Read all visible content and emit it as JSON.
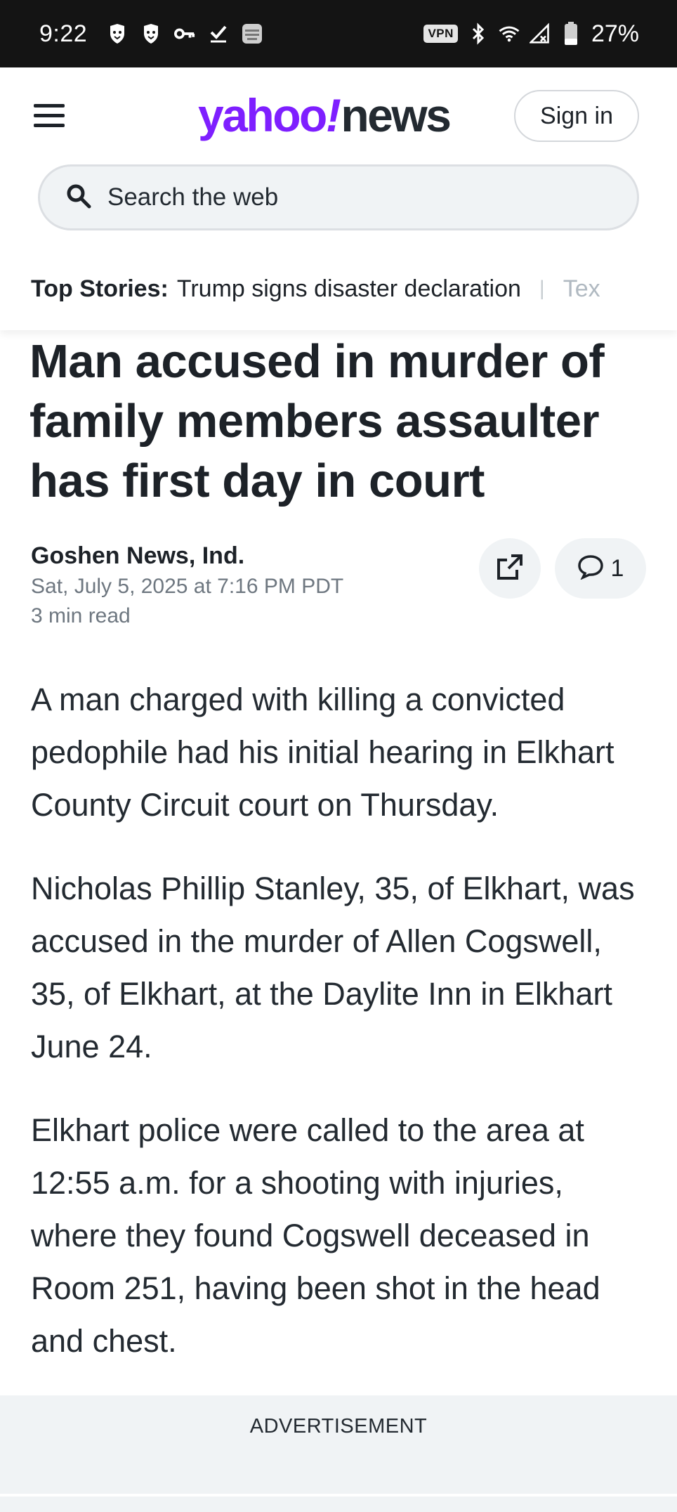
{
  "status_bar": {
    "time": "9:22",
    "vpn": "VPN",
    "battery": "27%"
  },
  "header": {
    "logo_yahoo": "yahoo",
    "logo_bang": "!",
    "logo_news": "news",
    "sign_in": "Sign in",
    "search_placeholder": "Search the web"
  },
  "top_stories": {
    "label": "Top Stories:",
    "items": [
      "Trump signs disaster declaration",
      "Tex"
    ]
  },
  "article": {
    "headline": "Man accused in murder of family members assaulter has first day in court",
    "source": "Goshen News, Ind.",
    "date": "Sat, July 5, 2025 at 7:16 PM PDT",
    "read_time": "3 min read",
    "comment_count": "1",
    "paragraphs": [
      "A man charged with killing a convicted pedophile had his initial hearing in Elkhart County Circuit court on Thursday.",
      "Nicholas Phillip Stanley, 35, of Elkhart, was accused in the murder of Allen Cogswell, 35, of Elkhart, at the Daylite Inn in Elkhart June 24.",
      "Elkhart police were called to the area at 12:55 a.m. for a shooting with injuries, where they found Cogswell deceased in Room 251, having been shot in the head and chest."
    ]
  },
  "ad": {
    "label": "ADVERTISEMENT"
  },
  "colors": {
    "brand_purple": "#7e1fff",
    "status_bar_bg": "#141414",
    "surface_gray": "#f0f3f5"
  }
}
